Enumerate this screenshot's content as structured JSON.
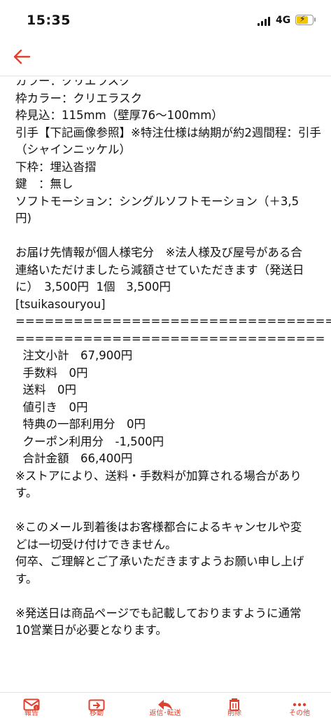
{
  "status": {
    "time": "15:35",
    "network": "4G"
  },
  "nav": {
    "back_icon": "back-arrow-icon"
  },
  "mail": {
    "lines": [
      "カラー：クリエラスク",
      "枠カラー：クリエラスク",
      "枠見込：115mm（壁厚76〜100mm）",
      "引手【下記画像参照】※特注仕様は納期が約2週間程：引手",
      "（シャインニッケル）",
      "下枠：埋込沓摺",
      "鍵　：無し",
      "ソフトモーション：シングルソフトモーション（＋3,5",
      "円)",
      "",
      "お届け先情報が個人様宅分　※法人様及び屋号がある合",
      "連絡いただけましたら減額させていただきます（発送日",
      "に）　3,500円  1個   3,500円",
      "[tsuikasouryou]",
      "======================================================",
      "================================",
      "  注文小計　67,900円",
      "  手数料　0円",
      "  送料　0円",
      "  値引き　0円",
      "  特典の一部利用分　0円",
      "  クーポン利用分　-1,500円",
      "  合計金額　66,400円",
      "※ストアにより、送料・手数料が加算される場合があり",
      "す。",
      "",
      "※このメール到着後はお客様都合によるキャンセルや変",
      "どは一切受け付けできません。",
      "何卒、ご理解とご了承いただきますようお願い申し上げ",
      "す。",
      "",
      "※発送日は商品ページでも記載しておりますように通常",
      "10営業日が必要となります。"
    ]
  },
  "toolbar": {
    "report": "報告",
    "move": "移動",
    "reply": "返信･転送",
    "delete": "削除",
    "more": "その他"
  },
  "colors": {
    "accent": "#e0412f"
  }
}
